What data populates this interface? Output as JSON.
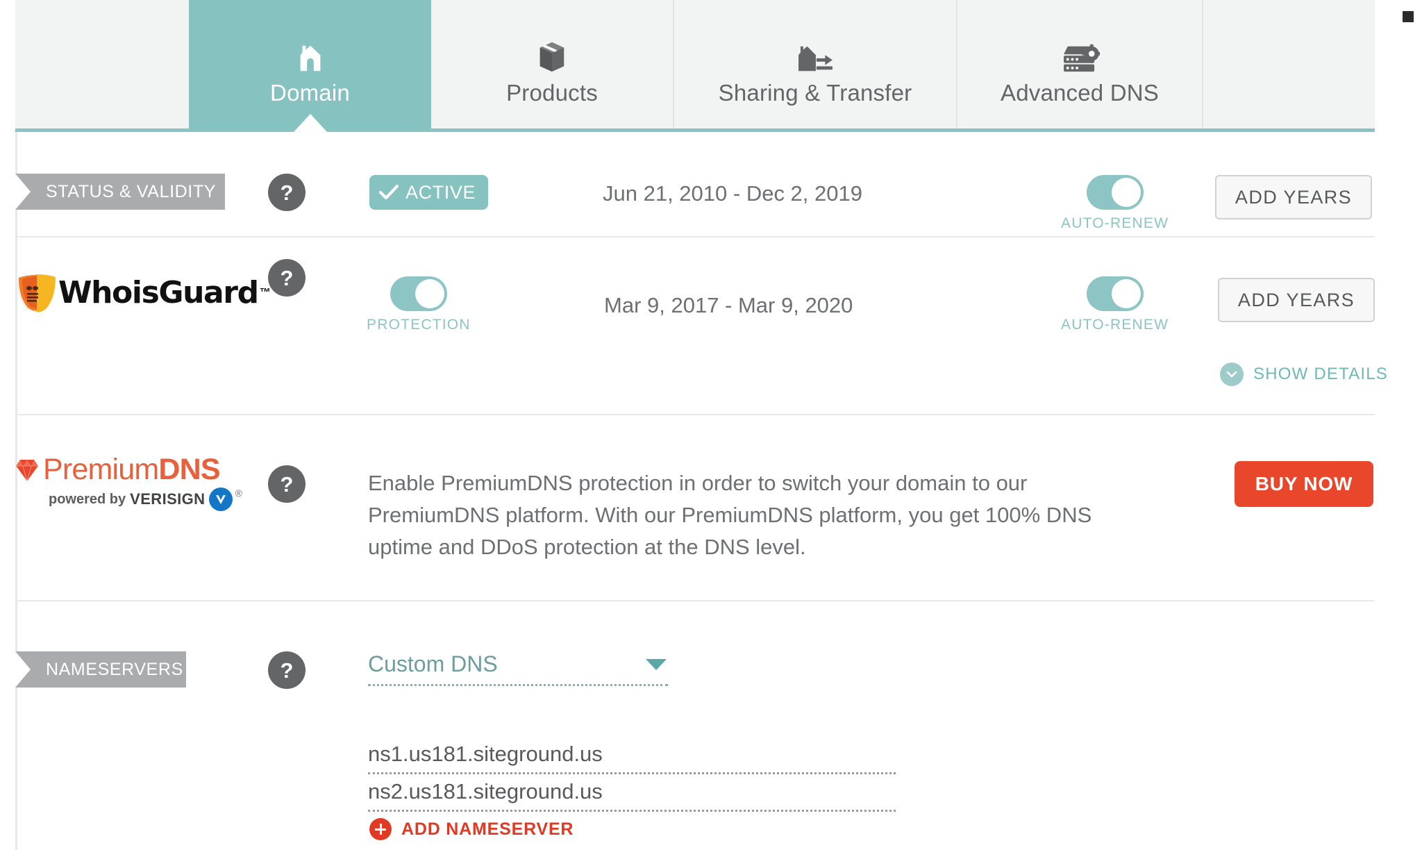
{
  "tabs": [
    {
      "id": "domain",
      "label": "Domain",
      "icon": "house-icon",
      "active": true
    },
    {
      "id": "products",
      "label": "Products",
      "icon": "box-icon",
      "active": false
    },
    {
      "id": "sharing",
      "label": "Sharing & Transfer",
      "icon": "house-transfer-icon",
      "active": false
    },
    {
      "id": "adns",
      "label": "Advanced DNS",
      "icon": "server-gear-icon",
      "active": false
    }
  ],
  "rows": {
    "status": {
      "ribbon_label": "STATUS & VALIDITY",
      "help": "?",
      "badge_label": "ACTIVE",
      "date_range": "Jun 21, 2010 - Dec 2, 2019",
      "toggle_label": "AUTO-RENEW",
      "toggle_on": true,
      "button_label": "ADD YEARS"
    },
    "whoisguard": {
      "logo_text": "WhoisGuard",
      "logo_tm": "™",
      "help": "?",
      "protection_label": "PROTECTION",
      "protection_on": true,
      "date_range": "Mar 9, 2017 - Mar 9, 2020",
      "toggle_label": "AUTO-RENEW",
      "toggle_on": true,
      "button_label": "ADD YEARS",
      "show_details_label": "SHOW DETAILS"
    },
    "premiumdns": {
      "logo_premium": "Premium",
      "logo_dns": "DNS",
      "logo_powered": "powered by",
      "logo_verisign": "VERISIGN",
      "logo_registered": "®",
      "help": "?",
      "description": "Enable PremiumDNS protection in order to switch your domain to our PremiumDNS platform. With our PremiumDNS platform, you get 100% DNS uptime and DDoS protection at the DNS level.",
      "button_label": "BUY NOW"
    },
    "nameservers": {
      "ribbon_label": "NAMESERVERS",
      "help": "?",
      "dns_type_selected": "Custom DNS",
      "nameserver_1": "ns1.us181.siteground.us",
      "nameserver_2": "ns2.us181.siteground.us",
      "add_label": "ADD NAMESERVER"
    }
  },
  "colors": {
    "teal": "#85c2c0",
    "teal_light": "#8cc5c3",
    "gray_ribbon": "#a9abad",
    "red_buy": "#e8472c",
    "red_add": "#e03a24",
    "orange_logo": "#e8603c",
    "blue_verisign": "#1476c6",
    "text_gray": "#6d6f71"
  }
}
